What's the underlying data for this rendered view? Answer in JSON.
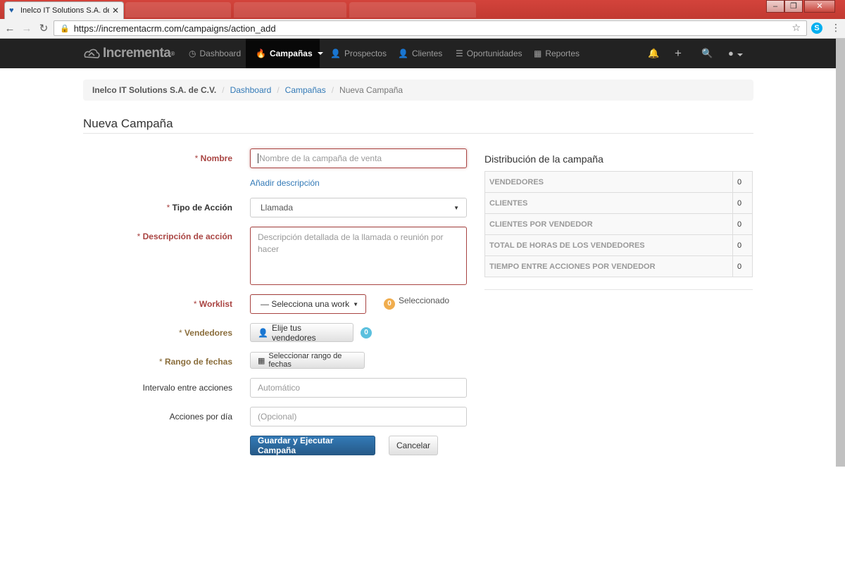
{
  "browser": {
    "tab_title": "Inelco IT Solutions S.A. de",
    "url": "https://incrementacrm.com/campaigns/action_add",
    "window_controls": [
      "minimize",
      "maximize",
      "close"
    ]
  },
  "navbar": {
    "brand": "Incrementa",
    "items": [
      {
        "label": "Dashboard",
        "icon": "dashboard-icon"
      },
      {
        "label": "Campañas",
        "icon": "fire-icon",
        "active": true
      },
      {
        "label": "Prospectos",
        "icon": "user-icon"
      },
      {
        "label": "Clientes",
        "icon": "user-icon"
      },
      {
        "label": "Oportunidades",
        "icon": "list-icon"
      },
      {
        "label": "Reportes",
        "icon": "chart-icon"
      }
    ],
    "right_icons": [
      "bell-icon",
      "plus-icon",
      "search-icon",
      "user-menu-icon"
    ]
  },
  "breadcrumb": {
    "company": "Inelco IT Solutions S.A. de C.V.",
    "links": [
      "Dashboard",
      "Campañas"
    ],
    "current": "Nueva Campaña"
  },
  "page_title": "Nueva Campaña",
  "form": {
    "nombre": {
      "label": "Nombre",
      "placeholder": "Nombre de la campaña de venta",
      "value": ""
    },
    "add_description": "Añadir descripción",
    "tipo_accion": {
      "label": "Tipo de Acción",
      "value": "Llamada"
    },
    "descripcion_accion": {
      "label": "Descripción de acción",
      "placeholder": "Descripción detallada de la llamada o reunión por hacer"
    },
    "worklist": {
      "label": "Worklist",
      "value": "— Selecciona una work",
      "selected_count": "0",
      "selected_text": "Seleccionado"
    },
    "vendedores": {
      "label": "Vendedores",
      "button": "Elije tus vendedores",
      "count": "0"
    },
    "rango_fechas": {
      "label": "Rango de fechas",
      "button": "Seleccionar rango de fechas"
    },
    "intervalo": {
      "label": "Intervalo entre acciones",
      "placeholder": "Automático"
    },
    "acciones_dia": {
      "label": "Acciones por día",
      "placeholder": "(Opcional)"
    },
    "required_mark": "*",
    "submit": "Guardar y Ejecutar Campaña",
    "cancel": "Cancelar"
  },
  "distribution": {
    "title": "Distribución de la campaña",
    "rows": [
      {
        "label": "VENDEDORES",
        "value": "0"
      },
      {
        "label": "CLIENTES",
        "value": "0"
      },
      {
        "label": "CLIENTES POR VENDEDOR",
        "value": "0"
      },
      {
        "label": "TOTAL DE HORAS DE LOS VENDEDORES",
        "value": "0"
      },
      {
        "label": "TIEMPO ENTRE ACCIONES POR VENDEDOR",
        "value": "0"
      }
    ]
  },
  "colors": {
    "required": "#a94442",
    "warning": "#8a6d3b",
    "link": "#337ab7",
    "primary": "#337ab7",
    "navbar": "#222222",
    "tab_strip": "#c23a32"
  }
}
